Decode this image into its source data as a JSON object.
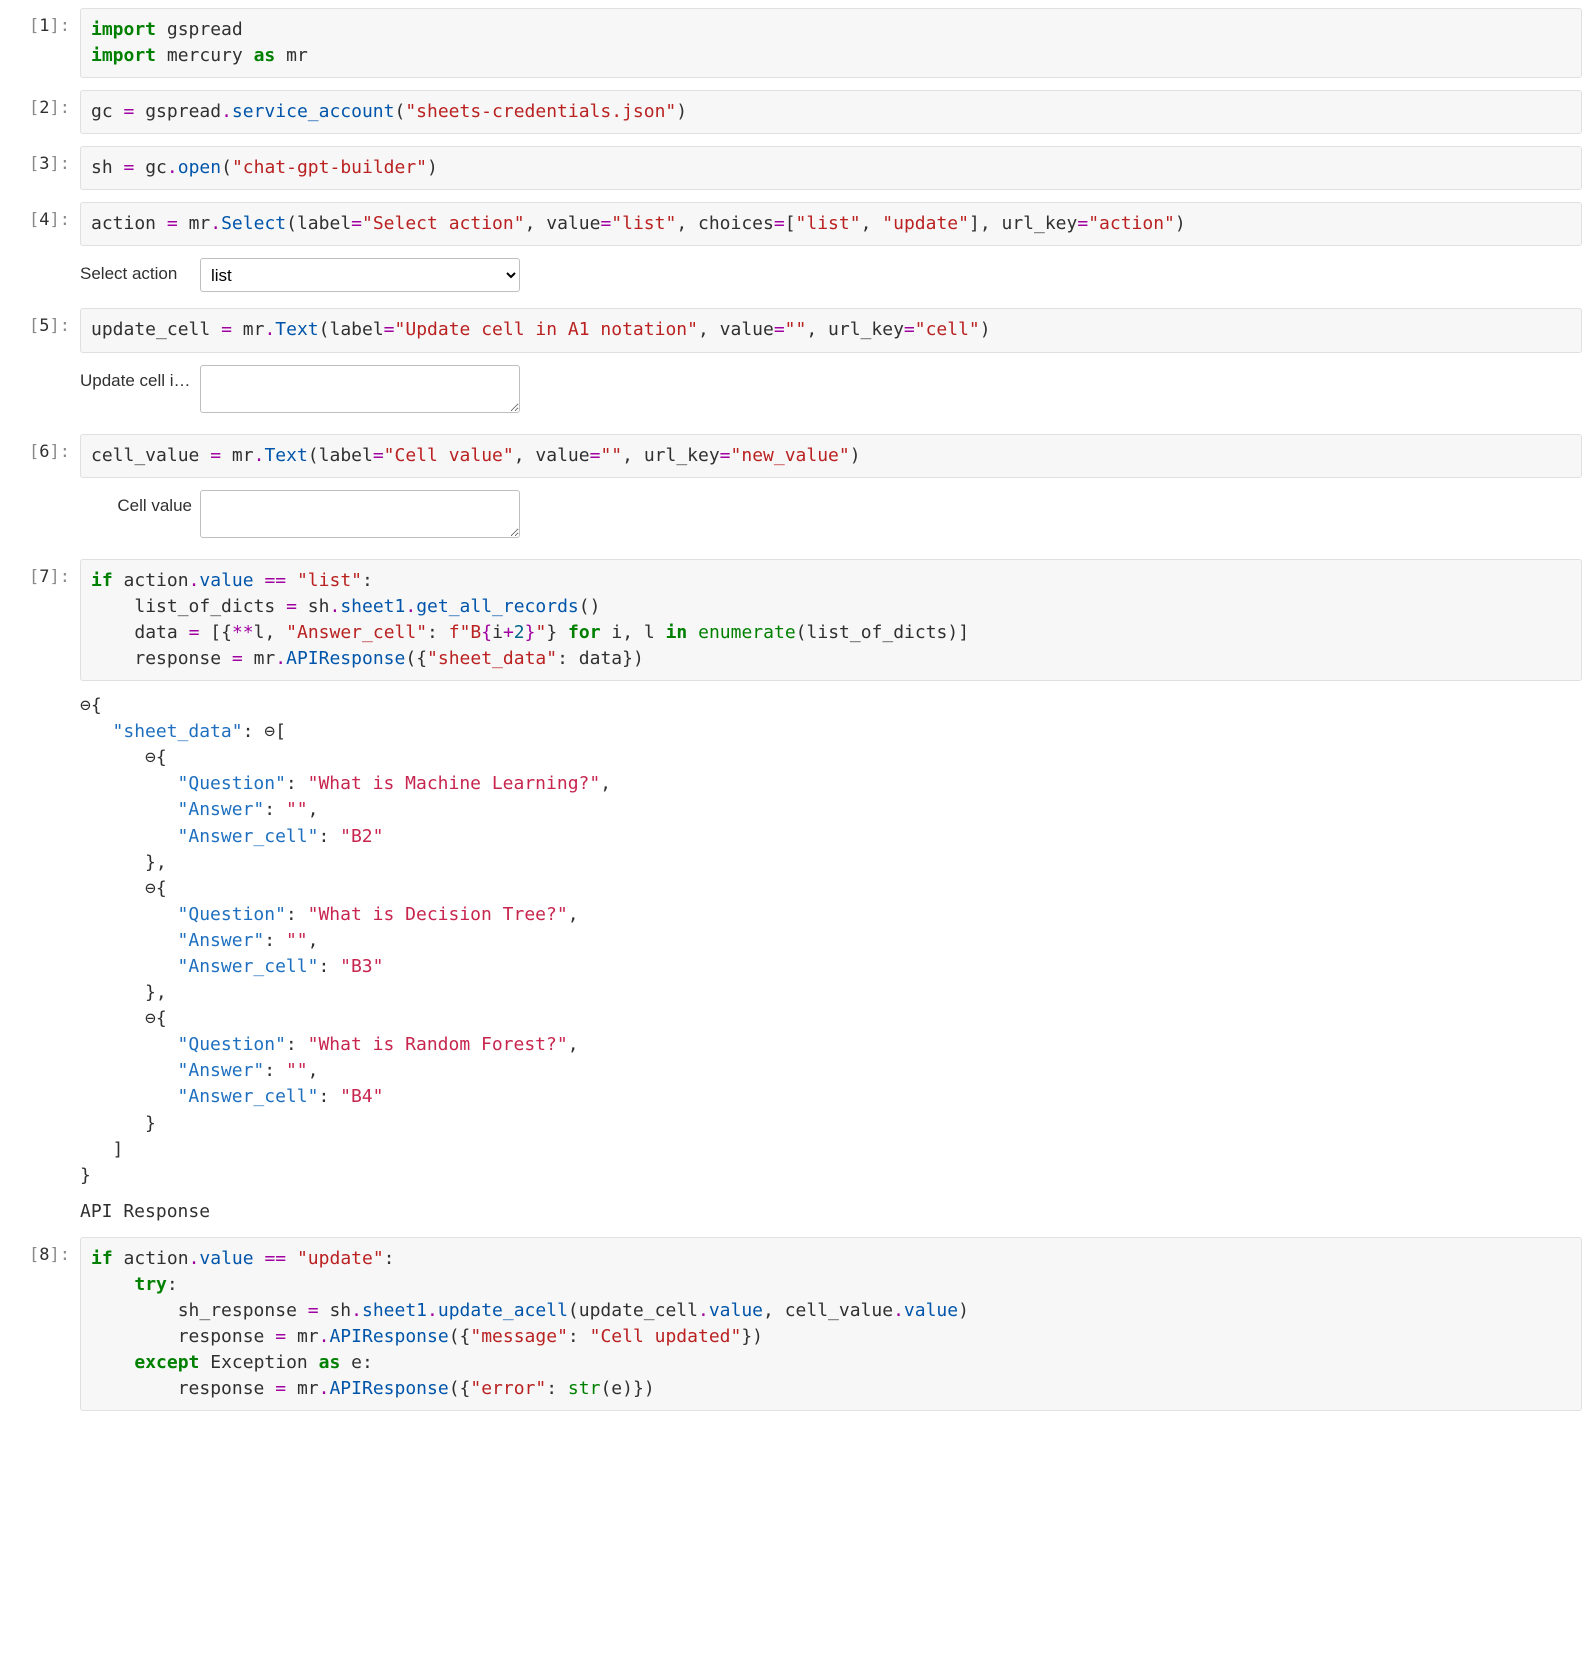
{
  "cells": {
    "c1": {
      "prompt": "[1]:"
    },
    "c2": {
      "prompt": "[2]:"
    },
    "c3": {
      "prompt": "[3]:"
    },
    "c4": {
      "prompt": "[4]:"
    },
    "c5": {
      "prompt": "[5]:"
    },
    "c6": {
      "prompt": "[6]:"
    },
    "c7": {
      "prompt": "[7]:"
    },
    "c8": {
      "prompt": "[8]:"
    }
  },
  "code": {
    "c1": {
      "import_kw": "import",
      "gspread": "gspread",
      "mercury": "mercury",
      "as_kw": "as",
      "mr": "mr"
    },
    "c2": {
      "gc": "gc",
      "eq": "=",
      "gspread": "gspread",
      "dot": ".",
      "service_account": "service_account",
      "lpar": "(",
      "rpar": ")",
      "arg": "\"sheets-credentials.json\""
    },
    "c3": {
      "sh": "sh",
      "eq": "=",
      "gc": "gc",
      "dot": ".",
      "open": "open",
      "lpar": "(",
      "rpar": ")",
      "arg": "\"chat-gpt-builder\""
    },
    "c4": {
      "action": "action",
      "eq": "=",
      "mr": "mr",
      "dot": ".",
      "Select": "Select",
      "lpar": "(",
      "label_k": "label",
      "label_v": "\"Select action\"",
      "value_k": "value",
      "value_v": "\"list\"",
      "choices_k": "choices",
      "lbra": "[",
      "rbra": "]",
      "ch1": "\"list\"",
      "ch2": "\"update\"",
      "urlkey_k": "url_key",
      "urlkey_v": "\"action\"",
      "rpar": ")",
      "comma": ", "
    },
    "c5": {
      "update_cell": "update_cell",
      "eq": "=",
      "mr": "mr",
      "dot": ".",
      "Text": "Text",
      "lpar": "(",
      "label_k": "label",
      "label_v": "\"Update cell in A1 notation\"",
      "value_k": "value",
      "value_v": "\"\"",
      "urlkey_k": "url_key",
      "urlkey_v": "\"cell\"",
      "rpar": ")",
      "comma": ", "
    },
    "c6": {
      "cell_value": "cell_value",
      "eq": "=",
      "mr": "mr",
      "dot": ".",
      "Text": "Text",
      "lpar": "(",
      "label_k": "label",
      "label_v": "\"Cell value\"",
      "value_k": "value",
      "value_v": "\"\"",
      "urlkey_k": "url_key",
      "urlkey_v": "\"new_value\"",
      "rpar": ")",
      "comma": ", "
    },
    "c7": {
      "if_kw": "if",
      "action": "action",
      "dot": ".",
      "value": "value",
      "eqeq": "==",
      "list_str": "\"list\"",
      "colon": ":",
      "list_of_dicts": "list_of_dicts",
      "eq": "=",
      "sh": "sh",
      "sheet1": "sheet1",
      "get_all_records": "get_all_records",
      "lpar": "(",
      "rpar": ")",
      "data": "data",
      "lbra": "[",
      "rbra": "]",
      "lbrace": "{",
      "rbrace": "}",
      "star2": "**",
      "l": "l",
      "comma": ", ",
      "answer_cell_k": "\"Answer_cell\"",
      "fprefix": "f",
      "fstr_open": "\"B",
      "fint_open": "{",
      "i": "i",
      "plus": "+",
      "two": "2",
      "fint_close": "}",
      "fstr_close": "\"",
      "for_kw": "for",
      "in_kw": "in",
      "enumerate": "enumerate",
      "response": "response",
      "mr": "mr",
      "APIResponse": "APIResponse",
      "sheet_data_k": "\"sheet_data\""
    },
    "c8": {
      "if_kw": "if",
      "action": "action",
      "dot": ".",
      "value": "value",
      "eqeq": "==",
      "update_str": "\"update\"",
      "colon": ":",
      "try_kw": "try",
      "sh_response": "sh_response",
      "eq": "=",
      "sh": "sh",
      "sheet1": "sheet1",
      "update_acell": "update_acell",
      "lpar": "(",
      "rpar": ")",
      "update_cell": "update_cell",
      "cell_value": "cell_value",
      "comma": ", ",
      "response": "response",
      "mr": "mr",
      "APIResponse": "APIResponse",
      "lbrace": "{",
      "rbrace": "}",
      "message_k": "\"message\"",
      "message_v": "\"Cell updated\"",
      "except_kw": "except",
      "Exception": "Exception",
      "as_kw": "as",
      "e": "e",
      "error_k": "\"error\"",
      "str_fn": "str"
    }
  },
  "widgets": {
    "select_action": {
      "label": "Select action",
      "value": "list",
      "options": [
        "list",
        "update"
      ]
    },
    "update_cell": {
      "label": "Update cell i…",
      "value": ""
    },
    "cell_value": {
      "label": "Cell value",
      "value": ""
    }
  },
  "json_output": {
    "toggle": "⊖",
    "lbrace": "{",
    "rbrace": "}",
    "lbra": "[",
    "rbra": "]",
    "comma": ",",
    "colon": ": ",
    "sheet_data_key": "\"sheet_data\"",
    "question_key": "\"Question\"",
    "answer_key": "\"Answer\"",
    "answer_cell_key": "\"Answer_cell\"",
    "items": [
      {
        "Question": "\"What is Machine Learning?\"",
        "Answer": "\"\"",
        "Answer_cell": "\"B2\""
      },
      {
        "Question": "\"What is Decision Tree?\"",
        "Answer": "\"\"",
        "Answer_cell": "\"B3\""
      },
      {
        "Question": "\"What is Random Forest?\"",
        "Answer": "\"\"",
        "Answer_cell": "\"B4\""
      }
    ],
    "api_response_label": "API Response"
  }
}
